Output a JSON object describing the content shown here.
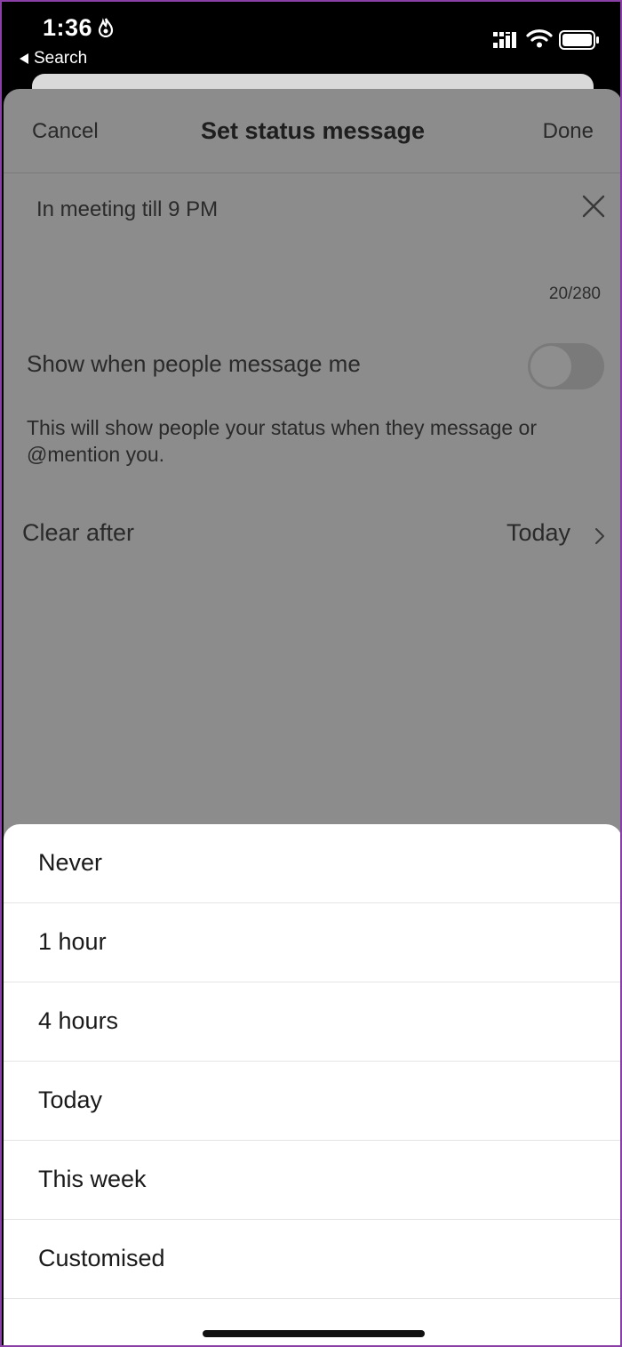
{
  "status_bar": {
    "time": "1:36",
    "back_label": "Search",
    "icons": [
      "flame-icon",
      "cellular-signal-icon",
      "wifi-icon",
      "battery-icon"
    ]
  },
  "nav": {
    "cancel_label": "Cancel",
    "title": "Set status message",
    "done_label": "Done"
  },
  "status_message": {
    "text": "In meeting till 9 PM",
    "counter": "20/280"
  },
  "show_when_messaged": {
    "label": "Show when people message me",
    "enabled": false,
    "description": "This will show people your status when they message or @mention you."
  },
  "clear_after": {
    "label": "Clear after",
    "value": "Today"
  },
  "clear_after_options": [
    "Never",
    "1 hour",
    "4 hours",
    "Today",
    "This week",
    "Customised"
  ],
  "colors": {
    "overlay": "#8c8c8c",
    "sheet": "#ffffff",
    "frame_border": "#8a3fa6"
  }
}
